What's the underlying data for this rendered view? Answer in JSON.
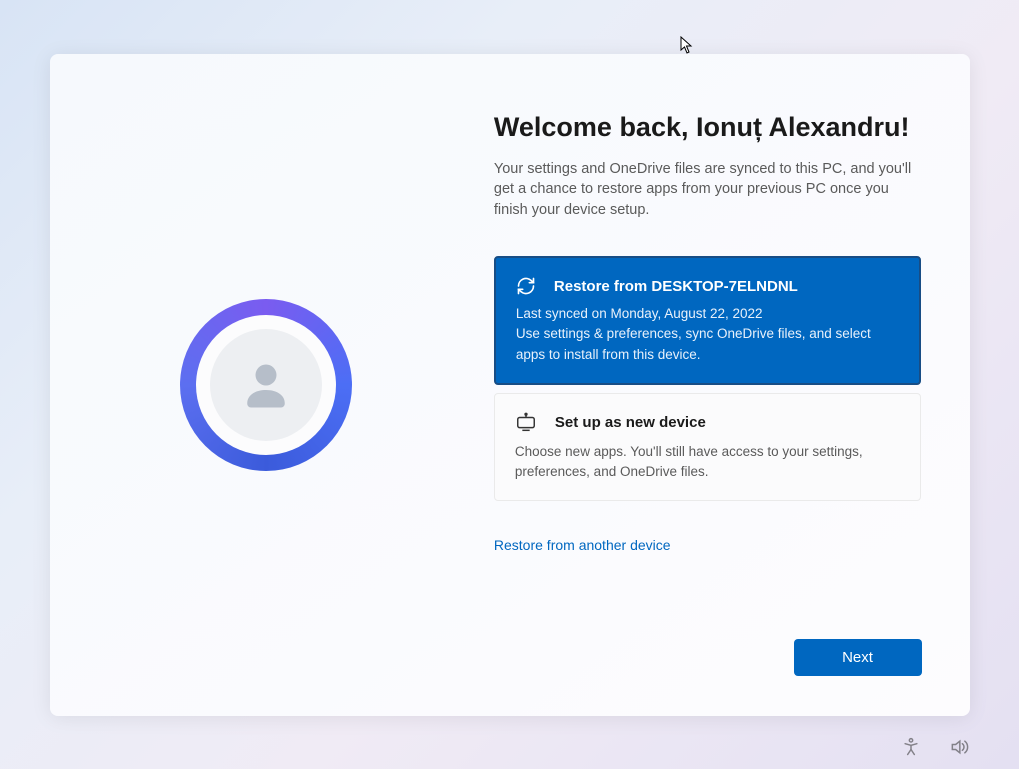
{
  "title": "Welcome back, Ionuț Alexandru!",
  "subtitle": "Your settings and OneDrive files are synced to this PC, and you'll get a chance to restore apps from your previous PC once you finish your device setup.",
  "options": {
    "restore": {
      "title": "Restore from DESKTOP-7ELNDNL",
      "line1": "Last synced on Monday, August 22, 2022",
      "line2": "Use settings & preferences, sync OneDrive files, and select apps to install from this device."
    },
    "new": {
      "title": "Set up as new device",
      "body": "Choose new apps. You'll still have access to your settings, preferences, and OneDrive files."
    }
  },
  "link": "Restore from another device",
  "nextButton": "Next"
}
